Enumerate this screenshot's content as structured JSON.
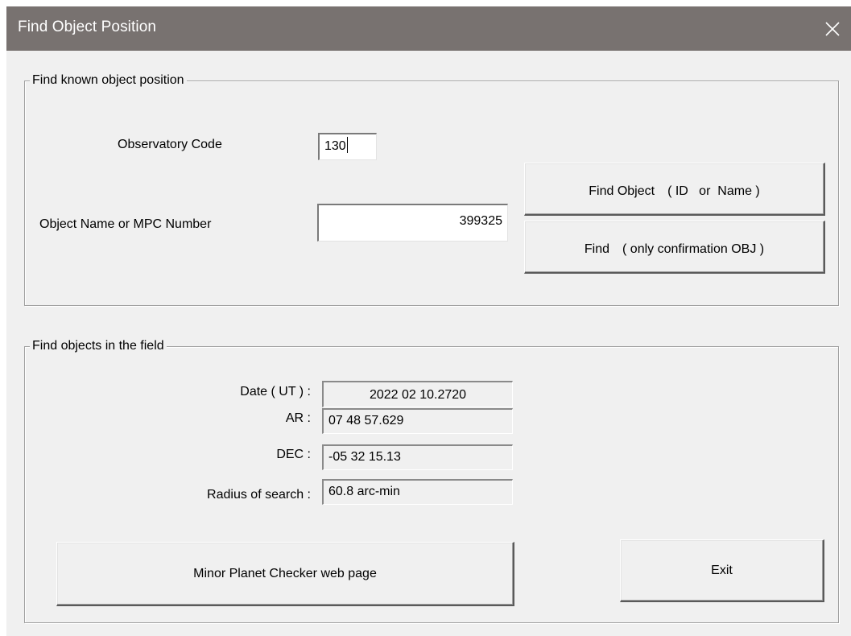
{
  "window": {
    "title": "Find Object Position",
    "close_icon": "close-icon"
  },
  "group_known": {
    "legend": "Find known object position",
    "observatory_label": "Observatory Code",
    "observatory_value": "130",
    "object_label": "Object Name  or MPC Number",
    "object_value": "399325",
    "find_object_button": "Find Object　( ID   or  Name )",
    "find_confirmation_button": "Find　( only confirmation OBJ )"
  },
  "group_field": {
    "legend": "Find objects in the field",
    "date_label": "Date ( UT ) :",
    "date_value": "2022 02 10.2720",
    "ar_label": "AR :",
    "ar_value": "07 48 57.629",
    "dec_label": "DEC :",
    "dec_value": "-05 32 15.13",
    "radius_label": "Radius of search :",
    "radius_value": "60.8   arc-min",
    "mpc_button": "Minor Planet Checker web page",
    "exit_button": "Exit"
  }
}
